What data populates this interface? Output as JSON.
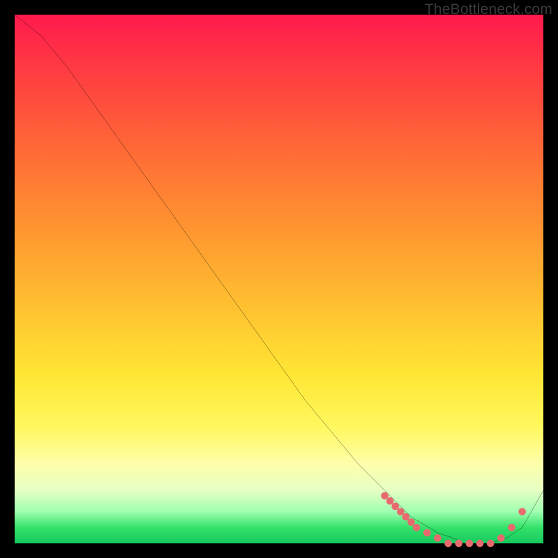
{
  "watermark": "TheBottleneck.com",
  "colors": {
    "background": "#000000",
    "curve": "#000000",
    "markers": "#e86a6f"
  },
  "chart_data": {
    "type": "line",
    "title": "",
    "xlabel": "",
    "ylabel": "",
    "xlim": [
      0,
      100
    ],
    "ylim": [
      0,
      100
    ],
    "series": [
      {
        "name": "bottleneck-curve",
        "x": [
          0,
          5,
          10,
          15,
          20,
          25,
          30,
          35,
          40,
          45,
          50,
          55,
          60,
          65,
          70,
          75,
          80,
          83,
          85,
          88,
          90,
          93,
          96,
          100
        ],
        "y": [
          100,
          96,
          90,
          83,
          76,
          69,
          62,
          55,
          48,
          41,
          34,
          27,
          21,
          15,
          10,
          5,
          2,
          1,
          0,
          0,
          0,
          1,
          3,
          10
        ]
      }
    ],
    "markers": {
      "name": "highlight-dots",
      "x": [
        70,
        71,
        72,
        73,
        74,
        75,
        76,
        78,
        80,
        82,
        84,
        86,
        88,
        90,
        92,
        94,
        96
      ],
      "y": [
        9,
        8,
        7,
        6,
        5,
        4,
        3,
        2,
        1,
        0,
        0,
        0,
        0,
        0,
        1,
        3,
        6
      ]
    }
  }
}
